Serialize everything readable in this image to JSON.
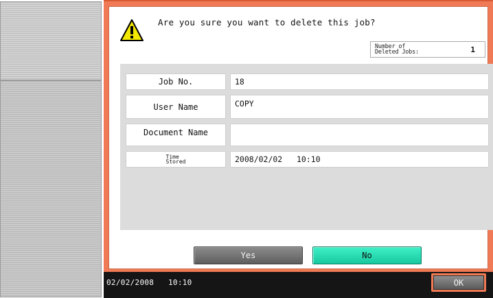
{
  "dialog": {
    "message": "Are you sure you want to delete this job?",
    "icon": "warning-icon",
    "deleted_jobs_label_line1": "Number of",
    "deleted_jobs_label_line2": "Deleted Jobs:",
    "deleted_jobs_count": "1"
  },
  "job_info": {
    "rows": [
      {
        "label": "Job No.",
        "value": "18"
      },
      {
        "label": "User Name",
        "value": "COPY"
      },
      {
        "label": "Document Name",
        "value": ""
      },
      {
        "label_line1": "Time",
        "label_line2": "Stored",
        "value": "2008/02/02   10:10"
      }
    ]
  },
  "buttons": {
    "yes_label": "Yes",
    "no_label": "No",
    "ok_label": "OK"
  },
  "status_bar": {
    "datetime": "02/02/2008   10:10"
  },
  "colors": {
    "frame_accent": "#f07a55",
    "selected_button": "#22d6ad",
    "panel_gray": "#dcdcdc",
    "status_bar_bg": "#151515"
  }
}
